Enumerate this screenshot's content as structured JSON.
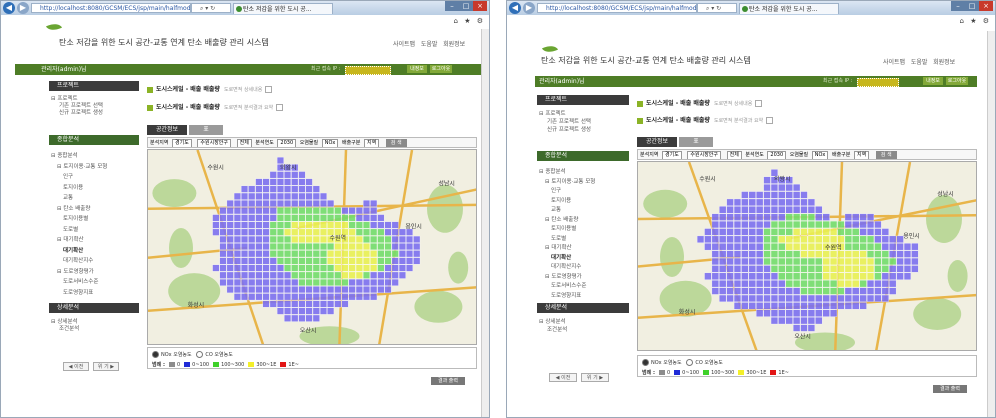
{
  "browser": {
    "address": "http://localhost:8080/GCSM/ECS/jsp/main/halfmodule.jsp",
    "tab_title": "탄소 저감을 위한 도시 공...",
    "tab_close": "×",
    "back_icon": "arrow-left-icon",
    "forward_icon": "arrow-right-icon",
    "tools_icons": "home-star-gear-icons",
    "min": "–",
    "max": "□",
    "close": "×"
  },
  "header": {
    "title": "탄소 저감을 위한 도시 공간-교통 연계 탄소 배출량 관리 시스템",
    "links": [
      "사이트맵",
      "도움말",
      "회원정보"
    ]
  },
  "greenbar": {
    "user": "관리자(admin)님",
    "session_label": "최근 접속 IP :",
    "btn_info": "내정보",
    "btn_logout": "로그아웃"
  },
  "sidebar": {
    "section1": "프로젝트",
    "proj_root": "⊟ 프로젝트",
    "proj_items": [
      "기존 프로젝트 선택",
      "신규 프로젝트 생성"
    ],
    "section2": "종합분석",
    "tree": [
      {
        "t": "⊟ 종합분석",
        "d": 0,
        "b": false
      },
      {
        "t": "⊟ 토지이용·교통 모형",
        "d": 1,
        "b": false
      },
      {
        "t": "인구",
        "d": 2,
        "b": false
      },
      {
        "t": "토지이용",
        "d": 2,
        "b": false
      },
      {
        "t": "교통",
        "d": 2,
        "b": false
      },
      {
        "t": "⊟ 탄소 배출량",
        "d": 1,
        "b": false
      },
      {
        "t": "토지이용별",
        "d": 2,
        "b": false
      },
      {
        "t": "도로별",
        "d": 2,
        "b": false
      },
      {
        "t": "⊟ 대기확산",
        "d": 1,
        "b": false
      },
      {
        "t": "대기확산",
        "d": 2,
        "b": true
      },
      {
        "t": "대기확산지수",
        "d": 2,
        "b": false
      },
      {
        "t": "⊟ 도로영향평가",
        "d": 1,
        "b": false
      },
      {
        "t": "도로서비스수준",
        "d": 2,
        "b": false
      },
      {
        "t": "도로영향지표",
        "d": 2,
        "b": false
      }
    ],
    "section3": "상세분석",
    "detail_root": "⊟ 상세분석",
    "detail_items": [
      "조건분석"
    ],
    "pager_prev": "◀ 이전",
    "pager_next": "위 기 ▶"
  },
  "content": {
    "row1_label": "도시스케일 - 배출 배출량",
    "row1_sub": "도로면적 상세내용",
    "row2_label": "도시스케일 - 배출 배출량",
    "row2_sub": "도로면적 분석결과 요약",
    "tab_active": "공간정보",
    "tab_inactive": "표",
    "filter": {
      "region_label": "분석지역",
      "province": "경기도",
      "city": "수원시장안구",
      "dong": "전체",
      "year_label": "분석연도",
      "year": "2030",
      "pollutant_label": "오염물질",
      "pollutant": "NOx",
      "emission_label": "배출구분",
      "emission": "지역",
      "search_btn": "검 색"
    },
    "map_places": [
      "수원시",
      "의왕시",
      "용인시",
      "화성시",
      "오산시",
      "성남시",
      "수원역"
    ],
    "legend": {
      "radio1": "NOx 오염농도",
      "radio2": "CO 오염농도",
      "range_label": "범례 :",
      "items": [
        {
          "label": "0",
          "color": "#8c8c8c"
        },
        {
          "label": "0~100",
          "color": "#1f2bd6"
        },
        {
          "label": "100~300",
          "color": "#3fd12a"
        },
        {
          "label": "300~1E",
          "color": "#f3ef2a"
        },
        {
          "label": "1E~",
          "color": "#e21515"
        }
      ]
    },
    "save_btn": "결과 출력"
  },
  "colors": {
    "grid_purple": "#7b6ff0",
    "grid_green": "#72dc6c",
    "grid_yellow": "#e8ef53",
    "header_green": "#4e7d26"
  }
}
